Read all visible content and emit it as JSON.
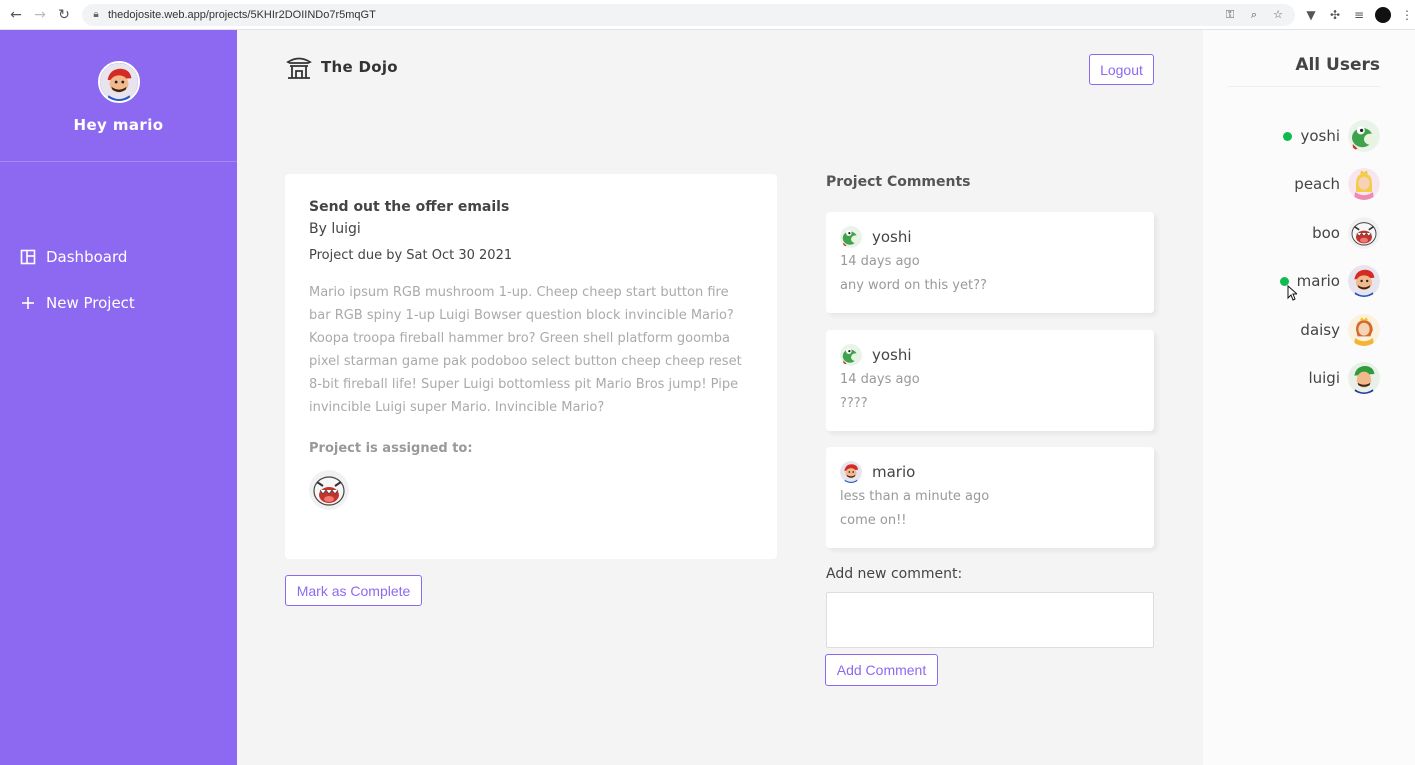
{
  "browser": {
    "url": "thedojosite.web.app/projects/5KHIr2DOIINDo7r5mqGT"
  },
  "sidebar": {
    "greeting": "Hey mario",
    "menu": [
      {
        "label": "Dashboard",
        "icon": "dashboard-icon"
      },
      {
        "label": "New Project",
        "icon": "plus-icon"
      }
    ]
  },
  "header": {
    "app_name": "The Dojo",
    "logout_label": "Logout"
  },
  "project": {
    "title": "Send out the offer emails",
    "by": "By luigi",
    "due": "Project due by Sat Oct 30 2021",
    "details": "Mario ipsum RGB mushroom 1-up. Cheep cheep start button fire bar RGB spiny 1-up Luigi Bowser question block invincible Mario? Koopa troopa fireball hammer bro? Green shell platform goomba pixel starman game pak podoboo select button cheep cheep reset 8-bit fireball life! Super Luigi bottomless pit Mario Bros jump! Pipe invincible Luigi super Mario. Invincible Mario?",
    "assigned_label": "Project is assigned to:",
    "assignees": [
      "boo"
    ],
    "complete_label": "Mark as Complete"
  },
  "comments": {
    "title": "Project Comments",
    "items": [
      {
        "name": "yoshi",
        "time": "14 days ago",
        "body": "any word on this yet??"
      },
      {
        "name": "yoshi",
        "time": "14 days ago",
        "body": "????"
      },
      {
        "name": "mario",
        "time": "less than a minute ago",
        "body": "come on!!"
      }
    ],
    "add_label": "Add new comment:",
    "add_button": "Add Comment"
  },
  "online_users": {
    "title": "All Users",
    "users": [
      {
        "name": "yoshi",
        "online": true
      },
      {
        "name": "peach",
        "online": false
      },
      {
        "name": "boo",
        "online": false
      },
      {
        "name": "mario",
        "online": true
      },
      {
        "name": "daisy",
        "online": false
      },
      {
        "name": "luigi",
        "online": false
      }
    ]
  },
  "colors": {
    "primary": "#8d69f1",
    "online": "#0ebb50",
    "background": "#f4f4f4"
  }
}
